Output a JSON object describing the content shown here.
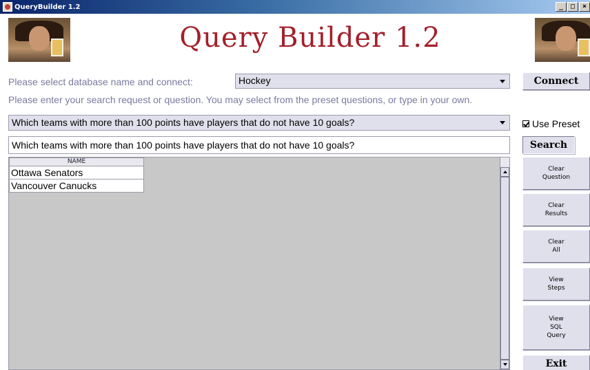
{
  "window": {
    "title": "QueryBuilder 1.2",
    "controls": [
      "_",
      "□",
      "×"
    ]
  },
  "banner": {
    "title": "Query Builder 1.2"
  },
  "database": {
    "label": "Please select database name and connect:",
    "selected": "Hockey",
    "connect_label": "Connect"
  },
  "question": {
    "instruction": "Please enter your search request or question.  You may select from the preset questions, or type in your own.",
    "preset_selected": "Which teams with more than 100 points have players that do not have 10 goals?",
    "use_preset_label": "Use Preset",
    "use_preset_checked": true,
    "input_value": "Which teams with more than 100 points have players that do not have 10 goals?",
    "search_label": "Search"
  },
  "results": {
    "columns": [
      "NAME"
    ],
    "rows": [
      [
        "Ottawa Senators"
      ],
      [
        "Vancouver Canucks"
      ]
    ]
  },
  "side_buttons": {
    "clear_question": "Clear\nQuestion",
    "clear_results": "Clear\nResults",
    "clear_all": "Clear\nAll",
    "view_steps": "View\nSteps",
    "view_sql": "View\nSQL\nQuery",
    "exit": "Exit"
  },
  "colors": {
    "banner_title": "#a31f2a",
    "label_text": "#7a7aa0",
    "control_bg": "#e0e0ec",
    "results_bg": "#c8c8c8"
  }
}
